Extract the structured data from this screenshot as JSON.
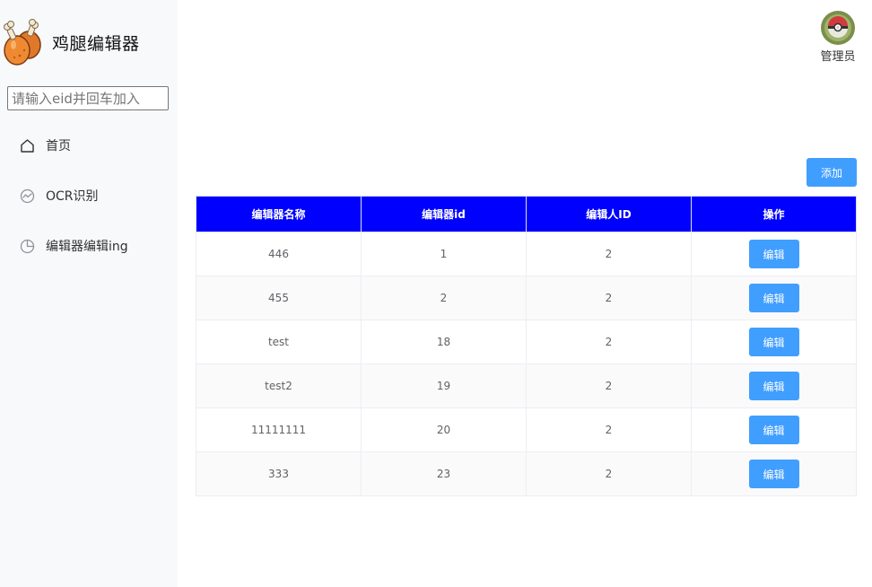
{
  "brand": {
    "title": "鸡腿编辑器",
    "logo_icon": "chicken-drumstick-icon"
  },
  "search": {
    "placeholder": "请输入eid并回车加入",
    "value": ""
  },
  "menu": {
    "items": [
      {
        "label": "首页",
        "icon": "home-icon"
      },
      {
        "label": "OCR识别",
        "icon": "ocr-icon"
      },
      {
        "label": "编辑器编辑ing",
        "icon": "pie-chart-icon"
      }
    ]
  },
  "user": {
    "name": "管理员",
    "avatar_icon": "wreath-avatar-icon"
  },
  "toolbar": {
    "add_label": "添加"
  },
  "table": {
    "headers": [
      "编辑器名称",
      "编辑器id",
      "编辑人ID",
      "操作"
    ],
    "rows": [
      {
        "name": "446",
        "editor_id": "1",
        "editor_user_id": "2",
        "action": "编辑"
      },
      {
        "name": "455",
        "editor_id": "2",
        "editor_user_id": "2",
        "action": "编辑"
      },
      {
        "name": "test",
        "editor_id": "18",
        "editor_user_id": "2",
        "action": "编辑"
      },
      {
        "name": "test2",
        "editor_id": "19",
        "editor_user_id": "2",
        "action": "编辑"
      },
      {
        "name": "11111111",
        "editor_id": "20",
        "editor_user_id": "2",
        "action": "编辑"
      },
      {
        "name": "333",
        "editor_id": "23",
        "editor_user_id": "2",
        "action": "编辑"
      }
    ]
  },
  "colors": {
    "accent": "#409eff",
    "table_header": "#0000ff",
    "sidebar_bg": "#f8f9fb"
  }
}
